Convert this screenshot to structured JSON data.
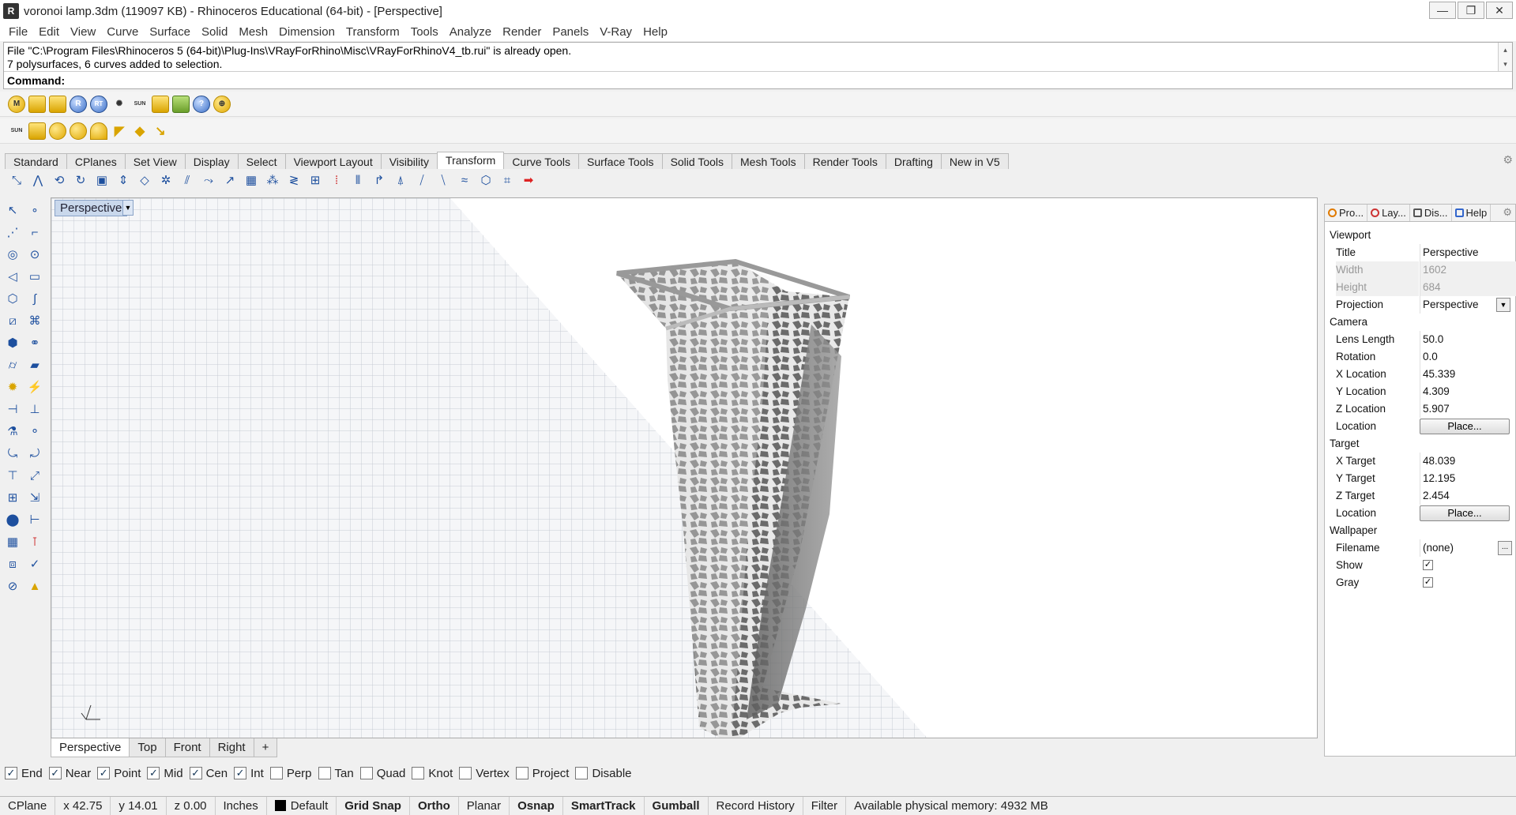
{
  "window": {
    "title": "voronoi lamp.3dm (119097 KB) - Rhinoceros Educational (64-bit) - [Perspective]"
  },
  "menu": [
    "File",
    "Edit",
    "View",
    "Curve",
    "Surface",
    "Solid",
    "Mesh",
    "Dimension",
    "Transform",
    "Tools",
    "Analyze",
    "Render",
    "Panels",
    "V-Ray",
    "Help"
  ],
  "command": {
    "history": [
      "File \"C:\\Program Files\\Rhinoceros 5 (64-bit)\\Plug-Ins\\VRayForRhino\\Misc\\VRayForRhinoV4_tb.rui\" is already open.",
      "7 polysurfaces, 6 curves added to selection."
    ],
    "prompt": "Command:"
  },
  "toolbar_vray": {
    "icons": [
      "M",
      "",
      "",
      "R",
      "RT",
      "",
      "SUN",
      "",
      "",
      "?",
      ""
    ]
  },
  "toolbar_vray2": {
    "icons": [
      "SUN",
      "",
      "",
      "",
      "",
      "",
      "",
      ""
    ]
  },
  "tabs": [
    "Standard",
    "CPlanes",
    "Set View",
    "Display",
    "Select",
    "Viewport Layout",
    "Visibility",
    "Transform",
    "Curve Tools",
    "Surface Tools",
    "Solid Tools",
    "Mesh Tools",
    "Render Tools",
    "Drafting",
    "New in V5"
  ],
  "active_tab": "Transform",
  "viewport": {
    "label": "Perspective"
  },
  "viewport_tabs": [
    "Perspective",
    "Top",
    "Front",
    "Right",
    "+"
  ],
  "panel": {
    "tabs": [
      "Pro...",
      "Lay...",
      "Dis...",
      "Help"
    ],
    "sections": {
      "viewport": "Viewport",
      "camera": "Camera",
      "target": "Target",
      "wallpaper": "Wallpaper"
    },
    "rows": {
      "title": {
        "label": "Title",
        "value": "Perspective"
      },
      "width": {
        "label": "Width",
        "value": "1602"
      },
      "height": {
        "label": "Height",
        "value": "684"
      },
      "projection": {
        "label": "Projection",
        "value": "Perspective"
      },
      "lens": {
        "label": "Lens Length",
        "value": "50.0"
      },
      "rotation": {
        "label": "Rotation",
        "value": "0.0"
      },
      "xloc": {
        "label": "X Location",
        "value": "45.339"
      },
      "yloc": {
        "label": "Y Location",
        "value": "4.309"
      },
      "zloc": {
        "label": "Z Location",
        "value": "5.907"
      },
      "camloc": {
        "label": "Location",
        "button": "Place..."
      },
      "xt": {
        "label": "X Target",
        "value": "48.039"
      },
      "yt": {
        "label": "Y Target",
        "value": "12.195"
      },
      "zt": {
        "label": "Z Target",
        "value": "2.454"
      },
      "tloc": {
        "label": "Location",
        "button": "Place..."
      },
      "filename": {
        "label": "Filename",
        "value": "(none)",
        "button": "..."
      },
      "show": {
        "label": "Show",
        "checked": true
      },
      "gray": {
        "label": "Gray",
        "checked": true
      }
    }
  },
  "osnap": [
    {
      "label": "End",
      "checked": true
    },
    {
      "label": "Near",
      "checked": true
    },
    {
      "label": "Point",
      "checked": true
    },
    {
      "label": "Mid",
      "checked": true
    },
    {
      "label": "Cen",
      "checked": true
    },
    {
      "label": "Int",
      "checked": true
    },
    {
      "label": "Perp",
      "checked": false
    },
    {
      "label": "Tan",
      "checked": false
    },
    {
      "label": "Quad",
      "checked": false
    },
    {
      "label": "Knot",
      "checked": false
    },
    {
      "label": "Vertex",
      "checked": false
    },
    {
      "label": "Project",
      "checked": false
    },
    {
      "label": "Disable",
      "checked": false
    }
  ],
  "status": {
    "cplane": "CPlane",
    "x": "x 42.75",
    "y": "y 14.01",
    "z": "z 0.00",
    "units": "Inches",
    "layer": "Default",
    "grid_snap": "Grid Snap",
    "ortho": "Ortho",
    "planar": "Planar",
    "osnap": "Osnap",
    "smarttrack": "SmartTrack",
    "gumball": "Gumball",
    "record": "Record History",
    "filter": "Filter",
    "memory": "Available physical memory: 4932 MB"
  }
}
